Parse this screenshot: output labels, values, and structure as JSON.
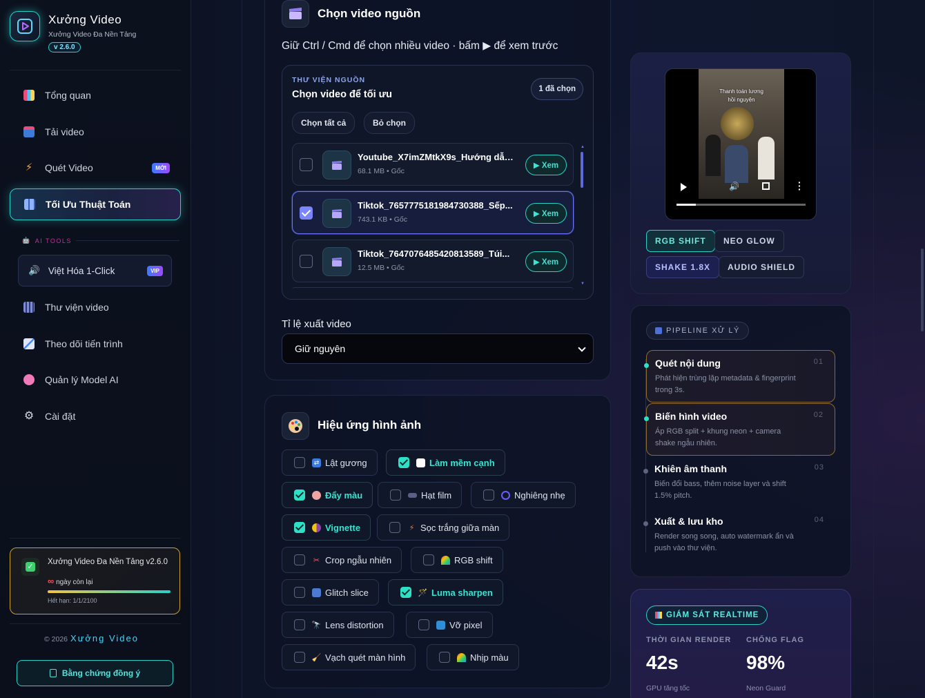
{
  "brand": {
    "title": "Xưởng Video",
    "subtitle": "Xưởng Video Đa Nền Tảng",
    "version": "v 2.6.0"
  },
  "nav": [
    {
      "label": "Tổng quan",
      "icon": "chart-icon"
    },
    {
      "label": "Tải video",
      "icon": "download-icon"
    },
    {
      "label": "Quét Video",
      "icon": "bolt-icon",
      "badge": "MỚI"
    },
    {
      "label": "Tối Ưu Thuật Toán",
      "icon": "grid-icon",
      "active": true
    },
    {
      "label": "Thư viện video",
      "icon": "film-icon"
    },
    {
      "label": "Theo dõi tiến trình",
      "icon": "trend-icon"
    },
    {
      "label": "Quản lý Model AI",
      "icon": "brain-icon"
    },
    {
      "label": "Cài đặt",
      "icon": "gear-icon"
    }
  ],
  "ai_tools": {
    "label": "AI TOOLS",
    "item": {
      "label": "Việt Hóa 1-Click",
      "badge": "VIP"
    }
  },
  "license": {
    "title": "Xưởng Video Đa Nền Tảng v2.6.0",
    "days": "ngày còn lại",
    "expiry": "Hết hạn: 1/1/2100"
  },
  "footer": {
    "copyright": "© 2026",
    "brand": "Xưởng Video",
    "proof_button": "Bằng chứng đồng ý"
  },
  "source": {
    "title": "Chọn video nguồn",
    "hint": "Giữ Ctrl / Cmd để chọn nhiều video · bấm ▶ để xem trước",
    "library_caption": "THƯ VIỆN NGUỒN",
    "library_title": "Chọn video để tối ưu",
    "selected_count": "1 đã chọn",
    "select_all": "Chọn tất cả",
    "deselect": "Bỏ chọn",
    "preview_label": "▶ Xem",
    "videos": [
      {
        "name": "Youtube_X7imZMtkX9s_Hướng dẫn ...",
        "meta": "68.1 MB • Gốc",
        "checked": false
      },
      {
        "name": "Tiktok_7657775181984730388_Sếp...",
        "meta": "743.1 KB • Gốc",
        "checked": true
      },
      {
        "name": "Tiktok_7647076485420813589_Túi...",
        "meta": "12.5 MB • Gốc",
        "checked": false
      }
    ],
    "ratio_label": "Tỉ lệ xuất video",
    "ratio_value": "Giữ nguyên"
  },
  "effects": {
    "title": "Hiệu ứng hình ảnh",
    "items": [
      {
        "label": "Lật gương",
        "checked": false
      },
      {
        "label": "Làm mềm cạnh",
        "checked": true
      },
      {
        "label": "Đẩy màu",
        "checked": true
      },
      {
        "label": "Hạt film",
        "checked": false
      },
      {
        "label": "Nghiêng nhẹ",
        "checked": false
      },
      {
        "label": "Vignette",
        "checked": true
      },
      {
        "label": "Sọc trắng giữa màn",
        "checked": false
      },
      {
        "label": "Crop ngẫu nhiên",
        "checked": false
      },
      {
        "label": "RGB shift",
        "checked": false
      },
      {
        "label": "Glitch slice",
        "checked": false
      },
      {
        "label": "Luma sharpen",
        "checked": true
      },
      {
        "label": "Lens distortion",
        "checked": false
      },
      {
        "label": "Vỡ pixel",
        "checked": false
      },
      {
        "label": "Vạch quét màn hình",
        "checked": false
      },
      {
        "label": "Nhịp màu",
        "checked": false
      }
    ]
  },
  "preview": {
    "overlay": "Thanh toán lương\nhồi nguyện",
    "tags": [
      "RGB SHIFT",
      "NEO GLOW",
      "SHAKE 1.8X",
      "AUDIO SHIELD"
    ]
  },
  "pipeline": {
    "title": "PIPELINE XỬ LÝ",
    "steps": [
      {
        "num": "01",
        "title": "Quét nội dung",
        "desc": "Phát hiện trùng lặp metadata & fingerprint trong 3s."
      },
      {
        "num": "02",
        "title": "Biến hình video",
        "desc": "Áp RGB split + khung neon + camera shake ngẫu nhiên."
      },
      {
        "num": "03",
        "title": "Khiên âm thanh",
        "desc": "Biến đổi bass, thêm noise layer và shift 1.5% pitch."
      },
      {
        "num": "04",
        "title": "Xuất & lưu kho",
        "desc": "Render song song, auto watermark ẩn và push vào thư viện."
      }
    ]
  },
  "monitor": {
    "title": "GIÁM SÁT REALTIME",
    "render_label": "THỜI GIAN RENDER",
    "render_value": "42s",
    "render_sub": "GPU tăng tốc",
    "flag_label": "CHỐNG FLAG",
    "flag_value": "98%",
    "flag_sub": "Neon Guard"
  },
  "colors": {
    "accent": "#2ad1c9",
    "purple": "#7a86ff",
    "gold": "#c9a227"
  }
}
